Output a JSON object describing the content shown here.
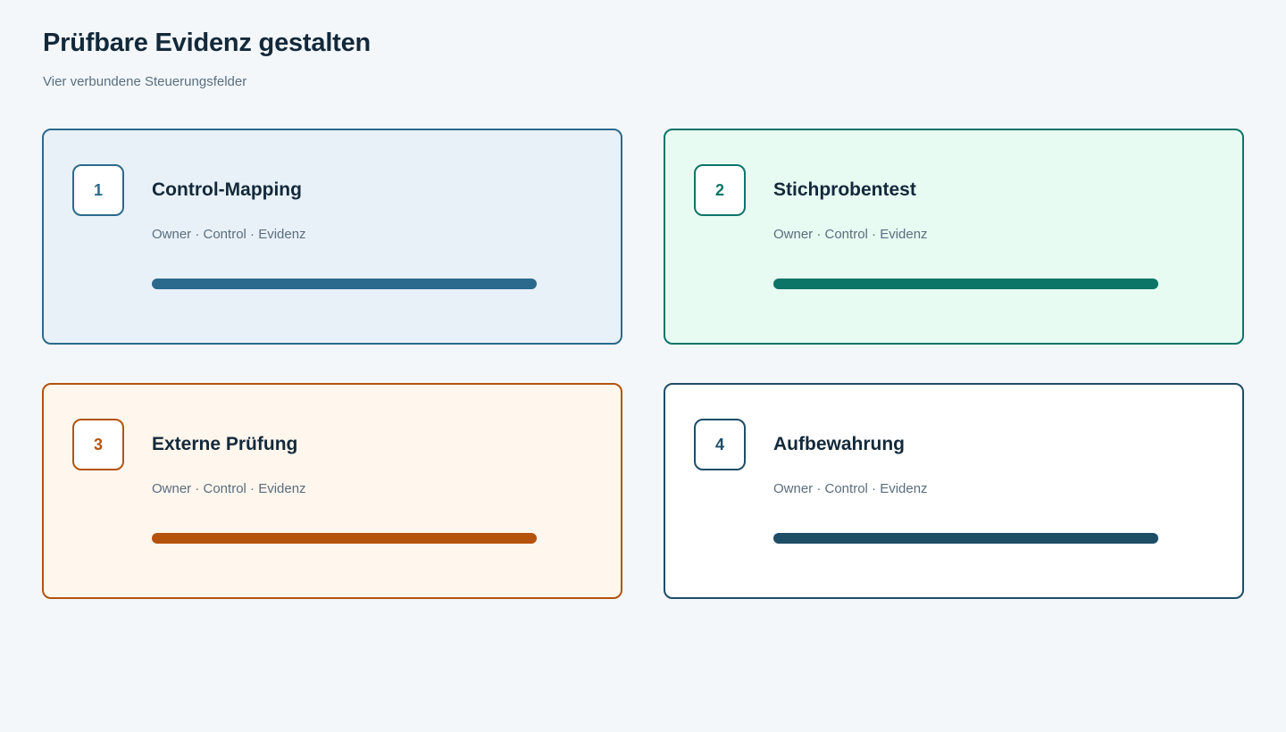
{
  "header": {
    "title": "Prüfbare Evidenz gestalten",
    "subtitle": "Vier verbundene Steuerungsfelder"
  },
  "cards": [
    {
      "number": "1",
      "title": "Control-Mapping",
      "meta": "Owner · Control · Evidenz",
      "progress": 1.0,
      "accent": "#2b6a8c",
      "background": "#e9f1f8"
    },
    {
      "number": "2",
      "title": "Stichprobentest",
      "meta": "Owner · Control · Evidenz",
      "progress": 1.0,
      "accent": "#0d7568",
      "background": "#e8fbf2"
    },
    {
      "number": "3",
      "title": "Externe Prüfung",
      "meta": "Owner · Control · Evidenz",
      "progress": 1.0,
      "accent": "#b5530d",
      "background": "#fff6ed"
    },
    {
      "number": "4",
      "title": "Aufbewahrung",
      "meta": "Owner · Control · Evidenz",
      "progress": 1.0,
      "accent": "#1e4d66",
      "background": "#ffffff"
    }
  ]
}
